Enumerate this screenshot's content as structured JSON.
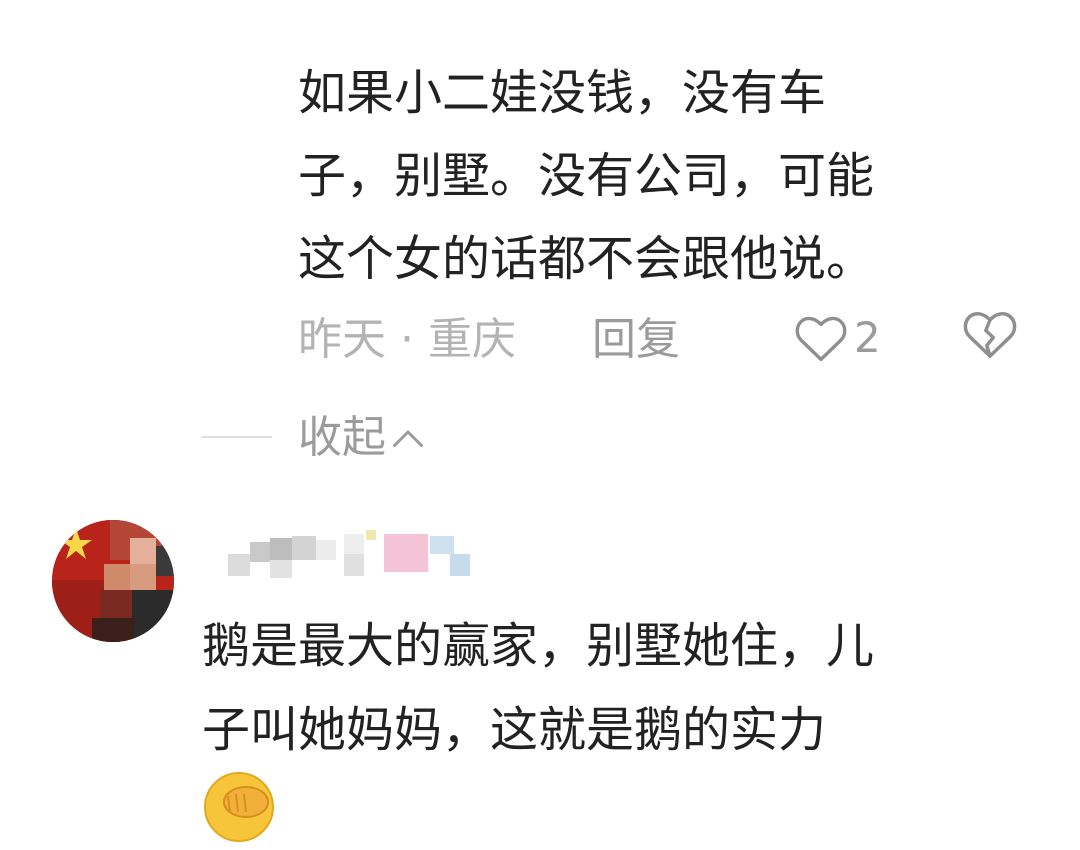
{
  "reply": {
    "lines": [
      "如果小二娃没钱，没有车",
      "子，别墅。没有公司，可能",
      "这个女的话都不会跟他说。"
    ],
    "time_location": "昨天 · 重庆",
    "reply_label": "回复",
    "like_icon": "heart-outline-icon",
    "like_count": "2",
    "dislike_icon": "broken-heart-icon"
  },
  "collapse": {
    "label": "收起",
    "icon": "chevron-up-icon"
  },
  "comment": {
    "avatar_icon": "avatar-flag-pixelated",
    "username_icon": "pixelated-username",
    "lines": [
      "鹅是最大的赢家，别墅她住，儿",
      "子叫她妈妈，这就是鹅的实力"
    ],
    "emoji_icon": "facepalm-emoji-icon"
  },
  "colors": {
    "text": "#222222",
    "meta": "#b3b3b3",
    "action": "#9b9b9b",
    "divider": "#dddddd"
  }
}
